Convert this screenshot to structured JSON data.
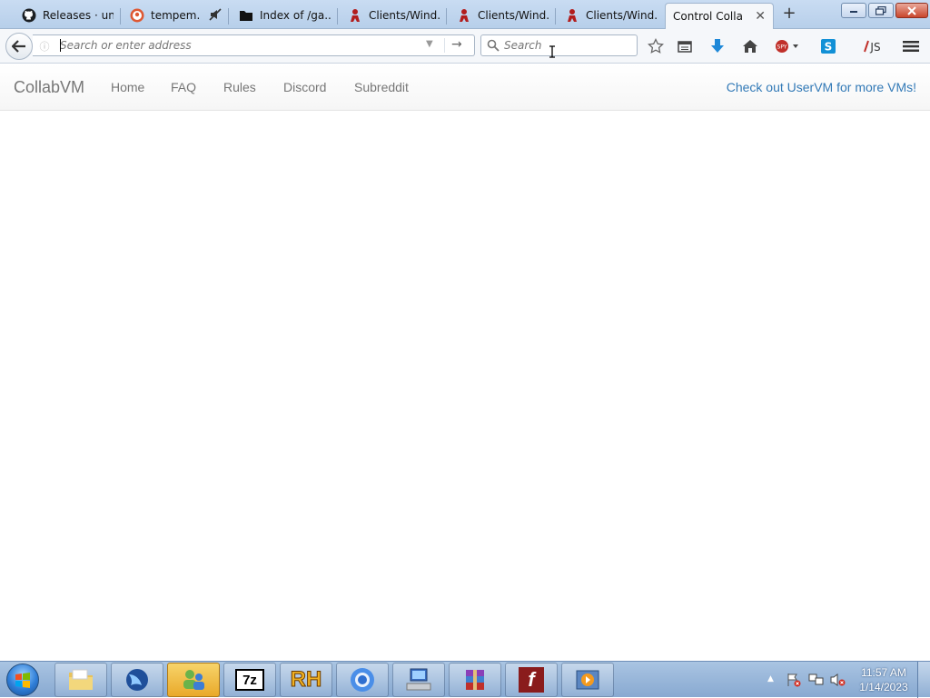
{
  "browser": {
    "tabs": [
      {
        "label": "Releases · un...",
        "icon": "github-icon"
      },
      {
        "label": "tempem...",
        "icon": "duckduckgo-icon"
      },
      {
        "label": "Index of /ga...",
        "icon": "folder-icon"
      },
      {
        "label": "Clients/Wind...",
        "icon": "person-icon"
      },
      {
        "label": "Clients/Wind...",
        "icon": "person-icon"
      },
      {
        "label": "Clients/Wind...",
        "icon": "person-icon"
      },
      {
        "label": "Control Colla...",
        "icon": "none",
        "active": true
      }
    ],
    "new_tab_symbol": "+",
    "url_placeholder": "Search or enter address",
    "search_placeholder": "Search",
    "toolbar_icons": [
      "star-icon",
      "reading-list-icon",
      "download-icon",
      "home-icon",
      "spy-icon",
      "skype-icon",
      "js-icon",
      "menu-icon"
    ],
    "toolbar_text": {
      "spy": "SPY",
      "js": "JS",
      "skype": "S"
    }
  },
  "site": {
    "brand": "CollabVM",
    "nav": [
      "Home",
      "FAQ",
      "Rules",
      "Discord",
      "Subreddit"
    ],
    "right_link": "Check out UserVM for more VMs!"
  },
  "taskbar": {
    "apps": [
      {
        "name": "explorer",
        "icon": "folder-icon"
      },
      {
        "name": "waterfox",
        "icon": "waterfox-icon"
      },
      {
        "name": "users",
        "icon": "users-icon"
      },
      {
        "name": "7zip",
        "icon": "7zip-icon",
        "text": "7z"
      },
      {
        "name": "reshacker",
        "icon": "rh-icon",
        "text": "RH"
      },
      {
        "name": "chrome",
        "icon": "chrome-icon"
      },
      {
        "name": "network",
        "icon": "network-icon"
      },
      {
        "name": "winrar",
        "icon": "winrar-icon"
      },
      {
        "name": "flash",
        "icon": "flash-icon",
        "text": "f"
      },
      {
        "name": "media",
        "icon": "media-icon"
      }
    ],
    "time": "11:57 AM",
    "date": "1/14/2023"
  },
  "colors": {
    "link_blue": "#337ab7",
    "nav_gray": "#777777",
    "taskbar_blue": "#88a9d1"
  }
}
